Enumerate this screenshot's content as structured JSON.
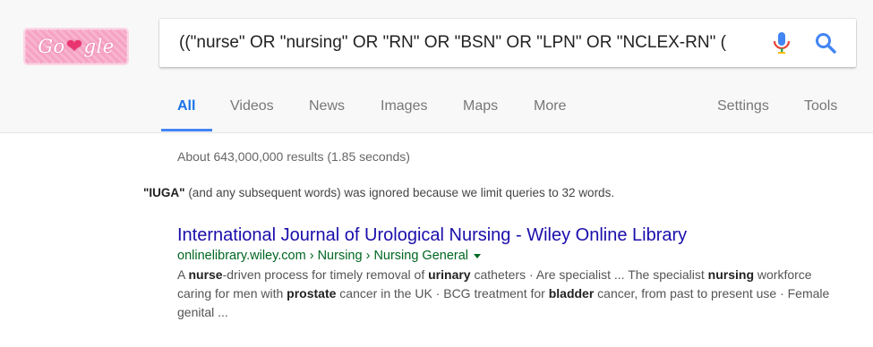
{
  "logo": {
    "text_left": "Go",
    "heart": "❤",
    "text_right": "gle"
  },
  "search": {
    "query": "((\"nurse\" OR \"nursing\" OR \"RN\" OR \"BSN\" OR \"LPN\" OR \"NCLEX-RN\" (",
    "icons": [
      "microphone-icon",
      "search-icon"
    ]
  },
  "tabs": {
    "all": "All",
    "videos": "Videos",
    "news": "News",
    "images": "Images",
    "maps": "Maps",
    "more": "More",
    "settings": "Settings",
    "tools": "Tools"
  },
  "results_stats": "About 643,000,000 results (1.85 seconds)",
  "ignored_note": {
    "word": "\"IUGA\"",
    "rest": " (and any subsequent words) was ignored because we limit queries to 32 words."
  },
  "results": [
    {
      "title": "International Journal of Urological Nursing - Wiley Online Library",
      "url": "onlinelibrary.wiley.com › Nursing › Nursing General",
      "snippet_parts": [
        {
          "t": "A ",
          "b": false
        },
        {
          "t": "nurse",
          "b": true
        },
        {
          "t": "-driven process for timely removal of ",
          "b": false
        },
        {
          "t": "urinary",
          "b": true
        },
        {
          "t": " catheters · Are specialist ... The specialist ",
          "b": false
        },
        {
          "t": "nursing",
          "b": true
        },
        {
          "t": " workforce caring for men with ",
          "b": false
        },
        {
          "t": "prostate",
          "b": true
        },
        {
          "t": " cancer in the UK · BCG treatment for ",
          "b": false
        },
        {
          "t": "bladder",
          "b": true
        },
        {
          "t": " cancer, from past to present use · Female genital ...",
          "b": false
        }
      ]
    }
  ],
  "colors": {
    "link": "#1a0dab",
    "url": "#006621",
    "tab_active": "#1a73e8",
    "accent_blue": "#4285f4"
  }
}
